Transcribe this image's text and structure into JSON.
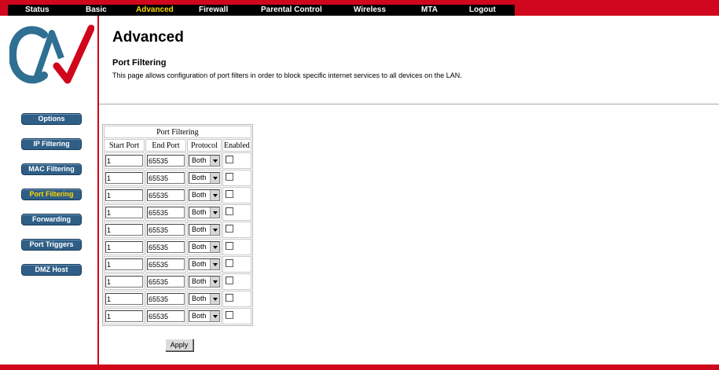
{
  "topnav": {
    "items": [
      {
        "label": "Status"
      },
      {
        "label": "Basic"
      },
      {
        "label": "Advanced"
      },
      {
        "label": "Firewall"
      },
      {
        "label": "Parental Control"
      },
      {
        "label": "Wireless"
      },
      {
        "label": "MTA"
      },
      {
        "label": "Logout"
      }
    ],
    "active": "Advanced"
  },
  "sidebar": {
    "items": [
      {
        "label": "Options"
      },
      {
        "label": "IP Filtering"
      },
      {
        "label": "MAC Filtering"
      },
      {
        "label": "Port Filtering"
      },
      {
        "label": "Forwarding"
      },
      {
        "label": "Port Triggers"
      },
      {
        "label": "DMZ Host"
      }
    ],
    "active": "Port Filtering"
  },
  "colors": {
    "brand_red": "#d0071c",
    "nav_black": "#000000",
    "active_yellow": "#ffd800",
    "button_blue": "#2f5f87"
  },
  "page": {
    "title": "Advanced",
    "section_title": "Port Filtering",
    "description": "This page allows configuration of port filters in order to block specific internet services to all devices on the LAN."
  },
  "table": {
    "caption": "Port Filtering",
    "headers": [
      "Start Port",
      "End Port",
      "Protocol",
      "Enabled"
    ],
    "rows": [
      {
        "start_port": "1",
        "end_port": "65535",
        "protocol": "Both",
        "enabled": false
      },
      {
        "start_port": "1",
        "end_port": "65535",
        "protocol": "Both",
        "enabled": false
      },
      {
        "start_port": "1",
        "end_port": "65535",
        "protocol": "Both",
        "enabled": false
      },
      {
        "start_port": "1",
        "end_port": "65535",
        "protocol": "Both",
        "enabled": false
      },
      {
        "start_port": "1",
        "end_port": "65535",
        "protocol": "Both",
        "enabled": false
      },
      {
        "start_port": "1",
        "end_port": "65535",
        "protocol": "Both",
        "enabled": false
      },
      {
        "start_port": "1",
        "end_port": "65535",
        "protocol": "Both",
        "enabled": false
      },
      {
        "start_port": "1",
        "end_port": "65535",
        "protocol": "Both",
        "enabled": false
      },
      {
        "start_port": "1",
        "end_port": "65535",
        "protocol": "Both",
        "enabled": false
      },
      {
        "start_port": "1",
        "end_port": "65535",
        "protocol": "Both",
        "enabled": false
      }
    ],
    "apply_label": "Apply"
  }
}
